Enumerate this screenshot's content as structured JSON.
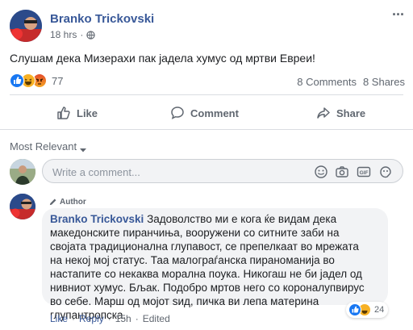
{
  "post": {
    "author": "Branko Trickovski",
    "time": "18 hrs",
    "separator": "·",
    "text": "Слушам дека Мизерахи пак јадела хумус од мртви Евреи!",
    "reactions_count": "77",
    "comments_count": "8 Comments",
    "shares_count": "8 Shares",
    "menu": "···"
  },
  "actions": {
    "like": "Like",
    "comment": "Comment",
    "share": "Share"
  },
  "sort": {
    "label": "Most Relevant"
  },
  "composer": {
    "placeholder": "Write a comment..."
  },
  "comment": {
    "badge": "Author",
    "author": "Branko Trickovski",
    "text": "Задоволство ми е кога ќе видам дека македонските пиранчиња, вооружени со ситните заби на својата традиционална глупавост, се препелкаат во мрежата на некој мој статус. Таа малограѓанска пираноманија во настапите со некаква морална поука. Никогаш не би јадел од нивниот хумус. Бљак. Подобро мртов него со короналупвирус во себе. Марш од мојот ѕид, пичка ви лепа материна глупантропска.",
    "reactions_count": "24",
    "like": "Like",
    "reply": "Reply",
    "time": "15h",
    "edited": "Edited",
    "dot": "·"
  },
  "colors": {
    "brand": "#385898",
    "like_blue": "#1877f2",
    "angry": "#e9710f",
    "haha": "#f7b125"
  }
}
